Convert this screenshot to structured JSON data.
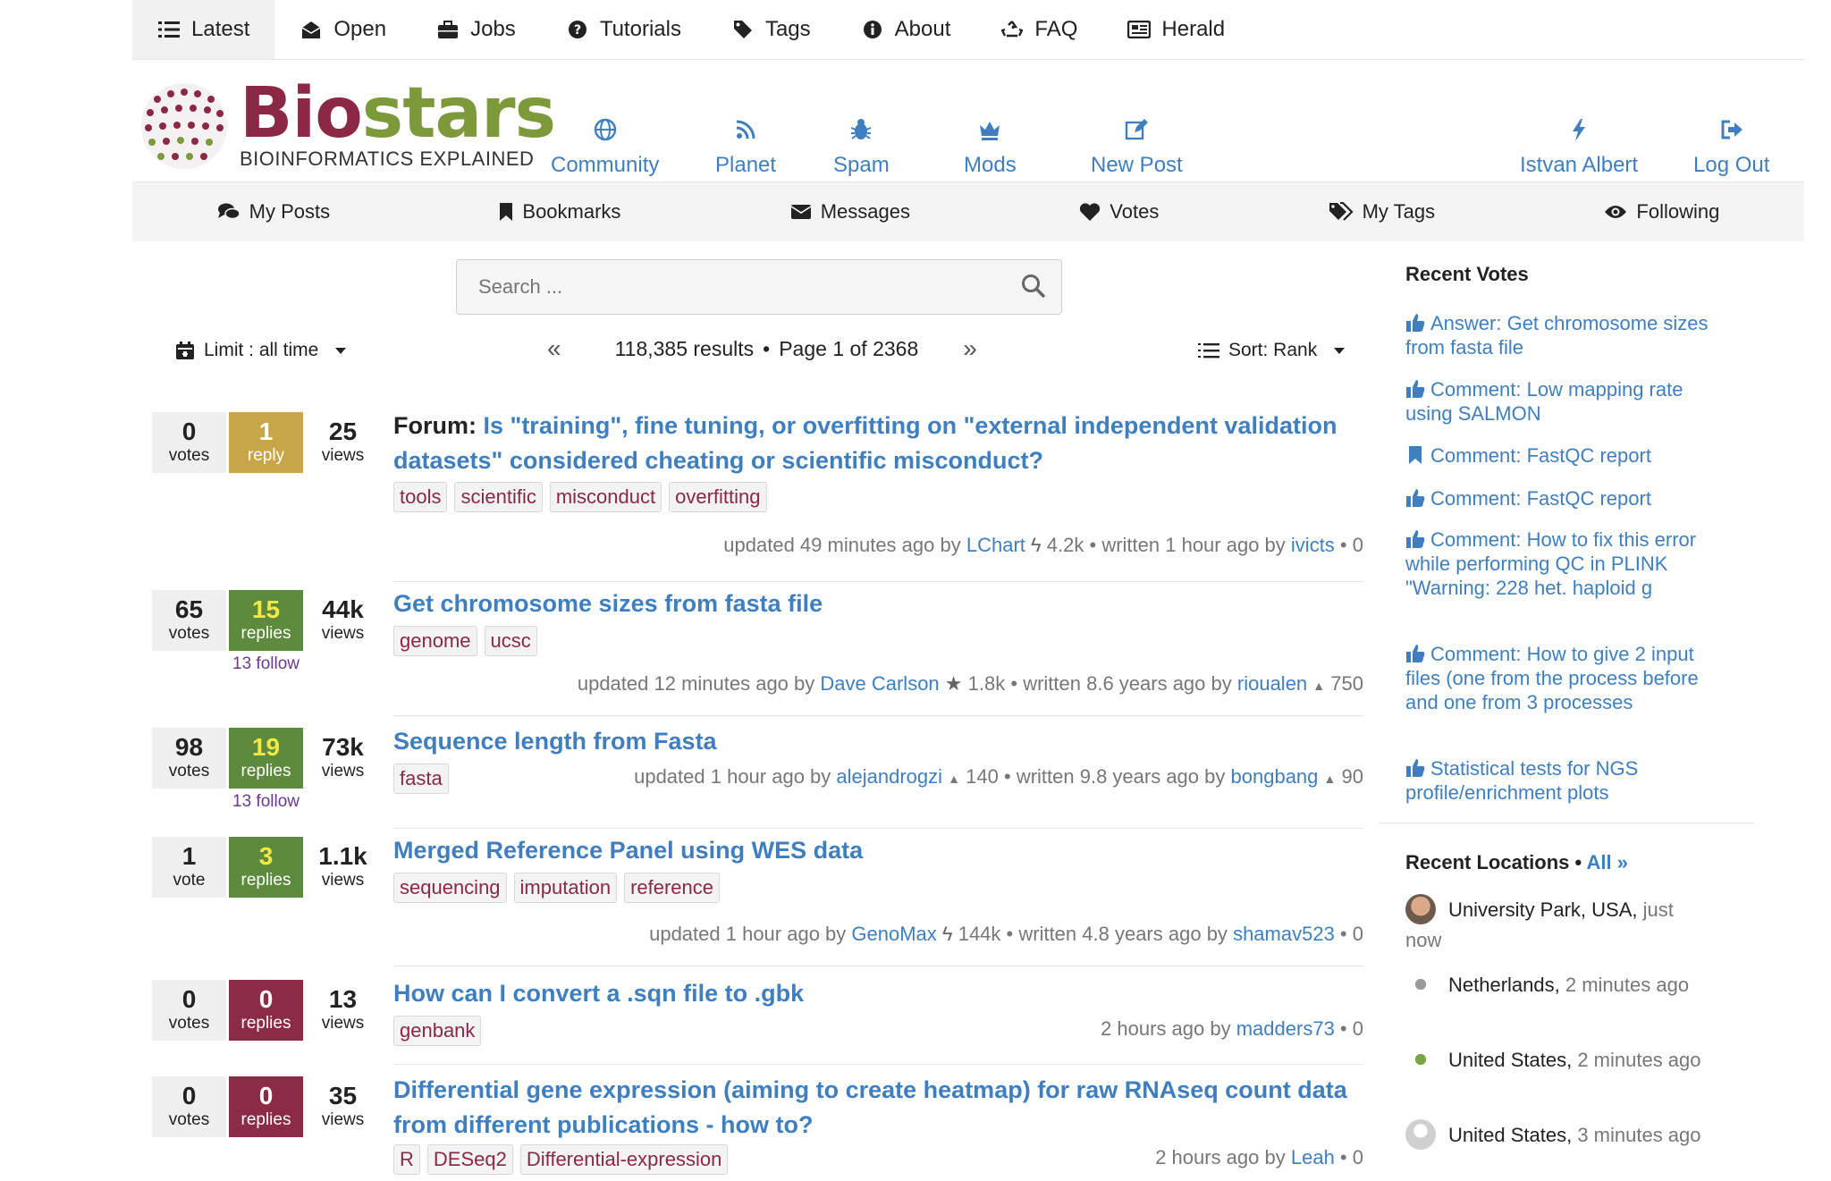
{
  "topnav": [
    {
      "label": "Latest",
      "icon": "list-icon"
    },
    {
      "label": "Open",
      "icon": "envelope-open-icon"
    },
    {
      "label": "Jobs",
      "icon": "briefcase-icon"
    },
    {
      "label": "Tutorials",
      "icon": "question-circle-icon"
    },
    {
      "label": "Tags",
      "icon": "tag-icon"
    },
    {
      "label": "About",
      "icon": "info-circle-icon"
    },
    {
      "label": "FAQ",
      "icon": "recycle-icon"
    },
    {
      "label": "Herald",
      "icon": "newspaper-icon"
    }
  ],
  "logo": {
    "bio_a": "Bio",
    "bio_b": "stars",
    "tagline": "BIOINFORMATICS EXPLAINED"
  },
  "header_nav": [
    {
      "label": "Community",
      "icon": "globe-icon"
    },
    {
      "label": "Planet",
      "icon": "rss-icon"
    },
    {
      "label": "Spam",
      "icon": "bug-icon"
    },
    {
      "label": "Mods",
      "icon": "crown-icon"
    },
    {
      "label": "New Post",
      "icon": "edit-icon"
    },
    {
      "label": "Istvan Albert",
      "icon": "bolt-icon"
    },
    {
      "label": "Log Out",
      "icon": "sign-out-icon"
    }
  ],
  "subnav": [
    {
      "label": "My Posts",
      "icon": "comments-icon"
    },
    {
      "label": "Bookmarks",
      "icon": "bookmark-icon"
    },
    {
      "label": "Messages",
      "icon": "envelope-icon"
    },
    {
      "label": "Votes",
      "icon": "heart-icon"
    },
    {
      "label": "My Tags",
      "icon": "tags-icon"
    },
    {
      "label": "Following",
      "icon": "eye-icon"
    }
  ],
  "search": {
    "placeholder": "Search ..."
  },
  "filters": {
    "limit": "Limit : all time",
    "results": "118,385 results",
    "page": "Page 1 of 2368",
    "sort": "Sort: Rank"
  },
  "posts": [
    {
      "votes": "0",
      "votes_label": "votes",
      "replies": "1",
      "replies_label": "reply",
      "views": "25",
      "views_label": "views",
      "follow": "",
      "prefix": "Forum: ",
      "title": "Is \"training\", fine tuning, or overfitting on \"external independent validation datasets\" considered cheating or scientific misconduct?",
      "tags": [
        "tools",
        "scientific",
        "misconduct",
        "overfitting"
      ],
      "meta_pre": "updated 49 minutes ago by",
      "user1": "LChart",
      "score1": "4.2k",
      "meta_mid": "written 1 hour ago by",
      "user2": "ivicts",
      "score2": "0"
    },
    {
      "votes": "65",
      "votes_label": "votes",
      "replies": "15",
      "replies_label": "replies",
      "views": "44k",
      "views_label": "views",
      "follow": "13 follow",
      "prefix": "",
      "title": "Get chromosome sizes from fasta file",
      "tags": [
        "genome",
        "ucsc"
      ],
      "meta_pre": "updated 12 minutes ago by",
      "user1": "Dave Carlson",
      "score1": "1.8k",
      "meta_mid": "written 8.6 years ago by",
      "user2": "rioualen",
      "score2": "750"
    },
    {
      "votes": "98",
      "votes_label": "votes",
      "replies": "19",
      "replies_label": "replies",
      "views": "73k",
      "views_label": "views",
      "follow": "13 follow",
      "prefix": "",
      "title": "Sequence length from Fasta",
      "tags": [
        "fasta"
      ],
      "meta_pre": "updated 1 hour ago by",
      "user1": "alejandrogzi",
      "score1": "140",
      "meta_mid": "written 9.8 years ago by",
      "user2": "bongbang",
      "score2": "90"
    },
    {
      "votes": "1",
      "votes_label": "vote",
      "replies": "3",
      "replies_label": "replies",
      "views": "1.1k",
      "views_label": "views",
      "follow": "",
      "prefix": "",
      "title": "Merged Reference Panel using WES data",
      "tags": [
        "sequencing",
        "imputation",
        "reference"
      ],
      "meta_pre": "updated 1 hour ago by",
      "user1": "GenoMax",
      "score1": "144k",
      "meta_mid": "written 4.8 years ago by",
      "user2": "shamav523",
      "score2": "0"
    },
    {
      "votes": "0",
      "votes_label": "votes",
      "replies": "0",
      "replies_label": "replies",
      "views": "13",
      "views_label": "views",
      "follow": "",
      "prefix": "",
      "title": "How can I convert a .sqn file to .gbk",
      "tags": [
        "genbank"
      ],
      "meta_pre": "2 hours ago by",
      "user1": "madders73",
      "score1": "0",
      "meta_mid": "",
      "user2": "",
      "score2": ""
    },
    {
      "votes": "0",
      "votes_label": "votes",
      "replies": "0",
      "replies_label": "replies",
      "views": "35",
      "views_label": "views",
      "follow": "",
      "prefix": "",
      "title": "Differential gene expression (aiming to create heatmap) for raw RNAseq count data from different publications - how to?",
      "tags": [
        "R",
        "DESeq2",
        "Differential-expression"
      ],
      "meta_pre": "2 hours ago by",
      "user1": "Leah",
      "score1": "0",
      "meta_mid": "",
      "user2": "",
      "score2": ""
    }
  ],
  "sidebar": {
    "recent_votes_title": "Recent Votes",
    "votes": [
      {
        "text": "Answer: Get chromosome sizes from fasta file",
        "icon": "thumbs-up-icon"
      },
      {
        "text": "Comment: Low mapping rate using SALMON",
        "icon": "thumbs-up-icon"
      },
      {
        "text": "Comment: FastQC report",
        "icon": "bookmark-icon"
      },
      {
        "text": "Comment: FastQC report",
        "icon": "thumbs-up-icon"
      },
      {
        "text": "Comment: How to fix this error while performing QC in PLINK \"Warning: 228 het. haploid g",
        "icon": "thumbs-up-icon"
      },
      {
        "text": "Comment: How to give 2 input files (one from the process before and one from 3 processes",
        "icon": "thumbs-up-icon"
      },
      {
        "text": "Statistical tests for NGS profile/enrichment plots",
        "icon": "thumbs-up-icon"
      }
    ],
    "recent_locations_title": "Recent Locations",
    "all_label": "All »",
    "locations": [
      {
        "place": "University Park, USA,",
        "time": "just now"
      },
      {
        "place": "Netherlands,",
        "time": "2 minutes ago"
      },
      {
        "place": "United States,",
        "time": "2 minutes ago"
      },
      {
        "place": "United States,",
        "time": "3 minutes ago"
      }
    ]
  },
  "colors": {
    "link": "#3f7fbf",
    "tag_text": "#8a2846",
    "gold": "#c9a54a",
    "green": "#5d8a3c",
    "red": "#8c2b46"
  }
}
